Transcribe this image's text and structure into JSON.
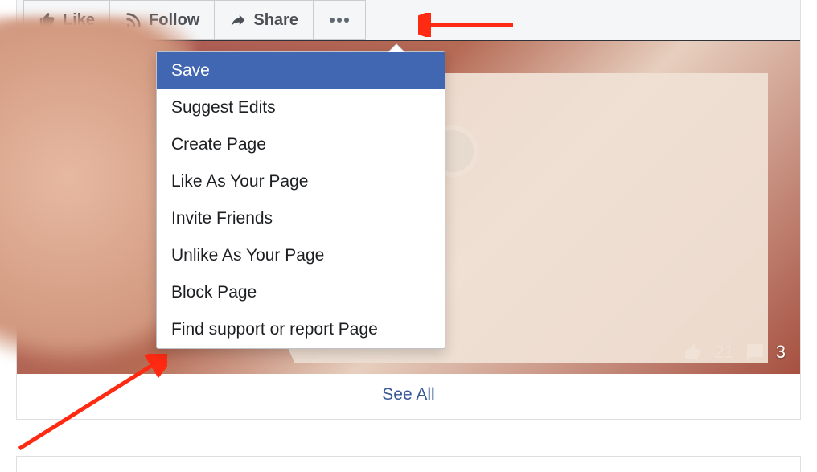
{
  "toolbar": {
    "like_label": "Like",
    "follow_label": "Follow",
    "share_label": "Share"
  },
  "menu": {
    "items": [
      "Save",
      "Suggest Edits",
      "Create Page",
      "Like As Your Page",
      "Invite Friends",
      "Unlike As Your Page",
      "Block Page",
      "Find support or report Page"
    ],
    "hover_index": 0
  },
  "reactions": {
    "like_count": "21",
    "comment_count": "3"
  },
  "footer": {
    "see_all": "See All"
  }
}
